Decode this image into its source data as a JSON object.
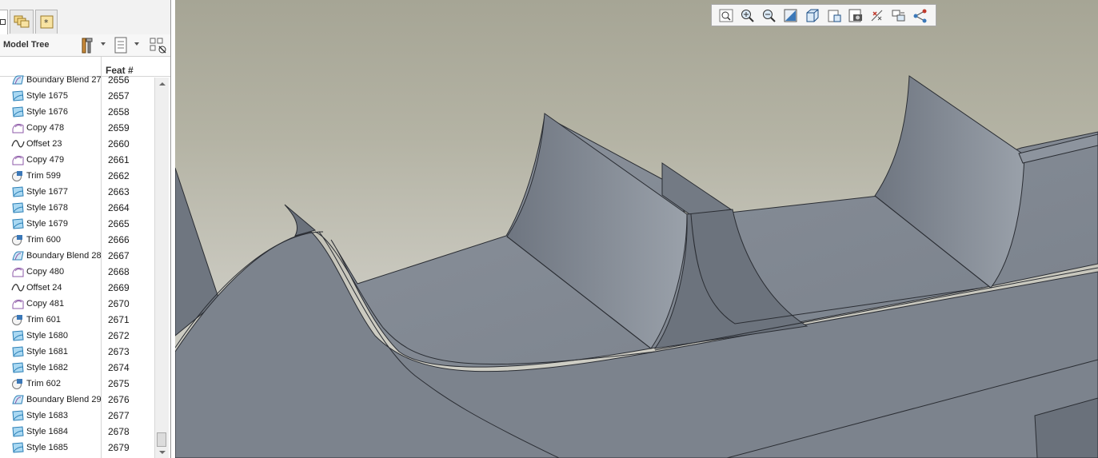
{
  "model_tree": {
    "label": "Model Tree",
    "feat_column_header": "Feat #",
    "rows": [
      {
        "icon": "boundary-blend-icon",
        "label": "Boundary Blend 27",
        "feat": "2656"
      },
      {
        "icon": "style-icon",
        "label": "Style 1675",
        "feat": "2657"
      },
      {
        "icon": "style-icon",
        "label": "Style 1676",
        "feat": "2658"
      },
      {
        "icon": "copy-icon",
        "label": "Copy 478",
        "feat": "2659"
      },
      {
        "icon": "offset-icon",
        "label": "Offset 23",
        "feat": "2660"
      },
      {
        "icon": "copy-icon",
        "label": "Copy 479",
        "feat": "2661"
      },
      {
        "icon": "trim-icon",
        "label": "Trim 599",
        "feat": "2662"
      },
      {
        "icon": "style-icon",
        "label": "Style 1677",
        "feat": "2663"
      },
      {
        "icon": "style-icon",
        "label": "Style 1678",
        "feat": "2664"
      },
      {
        "icon": "style-icon",
        "label": "Style 1679",
        "feat": "2665"
      },
      {
        "icon": "trim-icon",
        "label": "Trim 600",
        "feat": "2666"
      },
      {
        "icon": "boundary-blend-icon",
        "label": "Boundary Blend 28",
        "feat": "2667"
      },
      {
        "icon": "copy-icon",
        "label": "Copy 480",
        "feat": "2668"
      },
      {
        "icon": "offset-icon",
        "label": "Offset 24",
        "feat": "2669"
      },
      {
        "icon": "copy-icon",
        "label": "Copy 481",
        "feat": "2670"
      },
      {
        "icon": "trim-icon",
        "label": "Trim 601",
        "feat": "2671"
      },
      {
        "icon": "style-icon",
        "label": "Style 1680",
        "feat": "2672"
      },
      {
        "icon": "style-icon",
        "label": "Style 1681",
        "feat": "2673"
      },
      {
        "icon": "style-icon",
        "label": "Style 1682",
        "feat": "2674"
      },
      {
        "icon": "trim-icon",
        "label": "Trim 602",
        "feat": "2675"
      },
      {
        "icon": "boundary-blend-icon",
        "label": "Boundary Blend 29",
        "feat": "2676"
      },
      {
        "icon": "style-icon",
        "label": "Style 1683",
        "feat": "2677"
      },
      {
        "icon": "style-icon",
        "label": "Style 1684",
        "feat": "2678"
      },
      {
        "icon": "style-icon",
        "label": "Style 1685",
        "feat": "2679"
      }
    ]
  },
  "panel_tabs": [
    "model-tree-tab-icon",
    "folder-browser-icon",
    "favorites-icon"
  ],
  "panel_toolbar": [
    "settings-tools-icon",
    "show-columns-icon",
    "tree-filters-icon"
  ],
  "view_toolbar": [
    "refit-icon",
    "zoom-in-icon",
    "zoom-out-icon",
    "repaint-icon",
    "display-style-icon",
    "saved-orientations-icon",
    "view-manager-icon",
    "datum-display-icon",
    "spin-center-icon",
    "annotation-display-icon"
  ],
  "colors": {
    "background_top": "#a6a595",
    "background_bottom": "#d5d4cc",
    "part_surface": "#7f8690",
    "style_icon": "#5aa9d6"
  }
}
